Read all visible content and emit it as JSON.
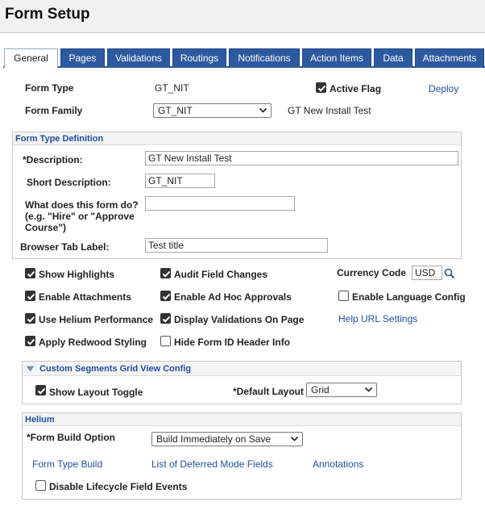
{
  "page": {
    "title": "Form Setup"
  },
  "tabs": [
    {
      "label": "General",
      "active": true
    },
    {
      "label": "Pages"
    },
    {
      "label": "Validations"
    },
    {
      "label": "Routings"
    },
    {
      "label": "Notifications"
    },
    {
      "label": "Action Items"
    },
    {
      "label": "Data"
    },
    {
      "label": "Attachments"
    }
  ],
  "header": {
    "form_type_label": "Form Type",
    "form_type_value": "GT_NIT",
    "active_flag_label": "Active Flag",
    "active_flag_checked": true,
    "deploy_link": "Deploy",
    "form_family_label": "Form Family",
    "form_family_value": "GT_NIT",
    "form_family_desc": "GT New Install Test"
  },
  "definition": {
    "heading": "Form Type Definition",
    "description_label": "*Description:",
    "description_value": "GT New Install Test",
    "short_desc_label": "Short Description:",
    "short_desc_value": "GT_NIT",
    "what_does_label_1": "What does this form do?",
    "what_does_label_2": "(e.g. \"Hire\" or \"Approve",
    "what_does_label_3": "Course\")",
    "what_does_value": "",
    "browser_tab_label": "Browser Tab Label:",
    "browser_tab_value": "Test title"
  },
  "options": {
    "show_highlights": "Show Highlights",
    "audit_field_changes": "Audit Field Changes",
    "currency_code_label": "Currency Code",
    "currency_code_value": "USD",
    "enable_attachments": "Enable Attachments",
    "enable_adhoc": "Enable Ad Hoc Approvals",
    "enable_language": "Enable Language Config",
    "use_helium": "Use Helium Performance",
    "display_validations": "Display Validations On Page",
    "help_url": "Help URL Settings",
    "apply_redwood": "Apply Redwood Styling",
    "hide_form_id": "Hide Form ID Header Info"
  },
  "segments": {
    "heading": "Custom Segments Grid View Config",
    "show_layout_toggle": "Show Layout Toggle",
    "default_layout_label": "*Default Layout",
    "default_layout_value": "Grid"
  },
  "helium": {
    "heading": "Helium",
    "build_option_label": "*Form Build Option",
    "build_option_value": "Build Immediately on Save",
    "form_type_build": "Form Type Build",
    "deferred_fields": "List of Deferred Mode Fields",
    "annotations": "Annotations",
    "disable_lifecycle": "Disable Lifecycle Field Events"
  },
  "colors": {
    "accent": "#2d5a9f",
    "link": "#1f4fa0"
  }
}
